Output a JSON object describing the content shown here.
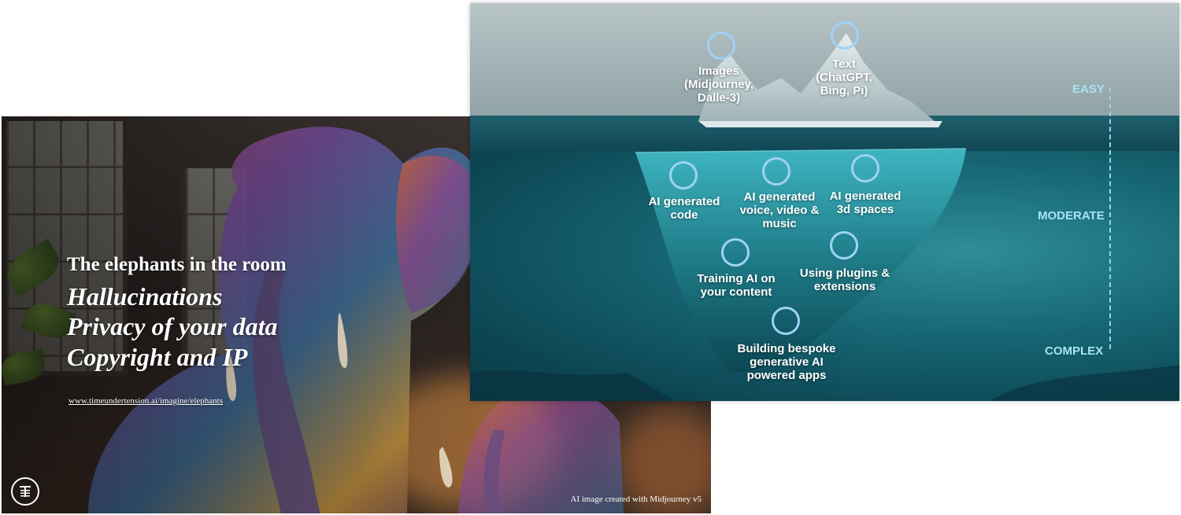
{
  "left_slide": {
    "heading": "The elephants in the room",
    "issues": [
      "Hallucinations",
      "Privacy of your data",
      "Copyright and IP"
    ],
    "link_text": "www.timeundertension.ai/imagine/elephants",
    "caption": "AI image created with Midjourney v5",
    "logo_icon": "time-under-tension-logo-icon"
  },
  "right_slide": {
    "above_water": [
      {
        "label": "Images (Midjourney, Dalle-3)"
      },
      {
        "label": "Text (ChatGPT, Bing, Pi)"
      }
    ],
    "below_water": [
      {
        "label": "AI generated code"
      },
      {
        "label": "AI generated voice, video & music"
      },
      {
        "label": "AI generated 3d spaces"
      },
      {
        "label": "Training AI on your content"
      },
      {
        "label": "Using plugins & extensions"
      },
      {
        "label": "Building bespoke generative AI powered apps"
      }
    ],
    "levels": [
      "EASY",
      "MODERATE",
      "COMPLEX"
    ],
    "colors": {
      "circle": "#9fd2f5",
      "level_text": "#a9e3f2",
      "water": "#176674"
    }
  }
}
